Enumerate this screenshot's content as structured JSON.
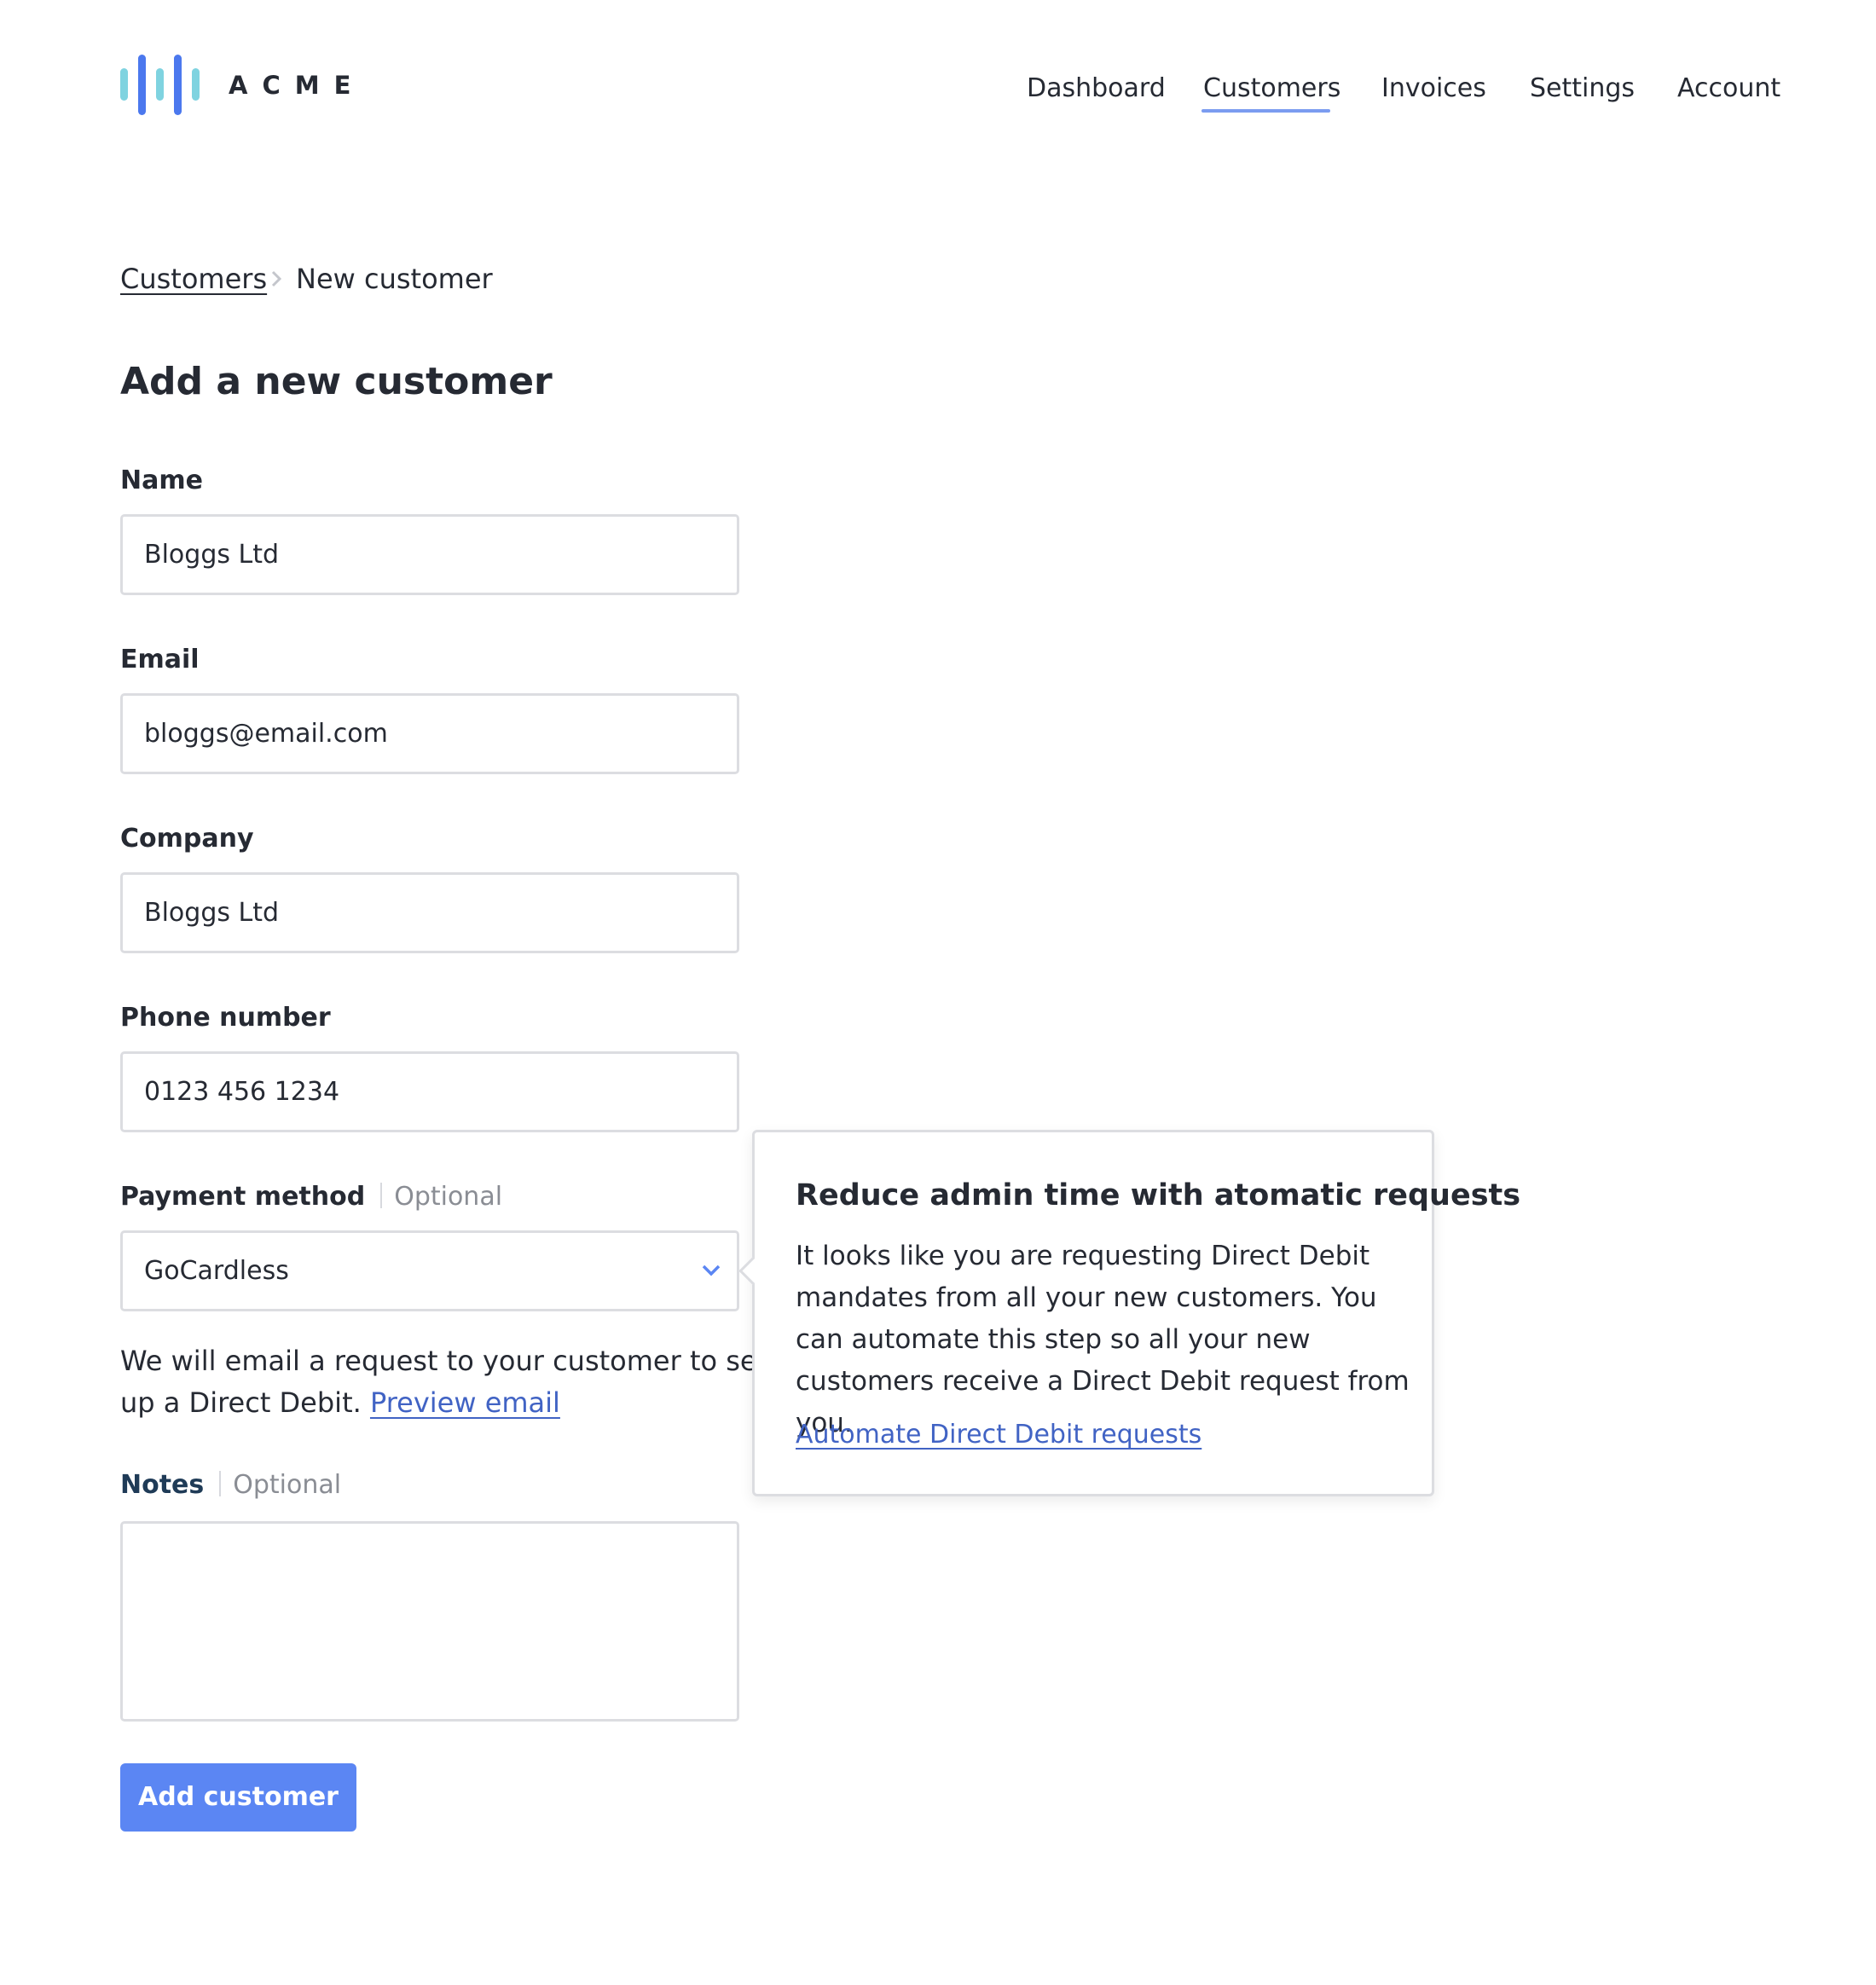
{
  "header": {
    "logo_text": "ACME",
    "nav": [
      {
        "label": "Dashboard"
      },
      {
        "label": "Customers",
        "active": true
      },
      {
        "label": "Invoices"
      },
      {
        "label": "Settings"
      },
      {
        "label": "Account"
      }
    ]
  },
  "breadcrumb": {
    "parent": "Customers",
    "current": "New customer"
  },
  "page_title": "Add a new customer",
  "form": {
    "name": {
      "label": "Name",
      "value": "Bloggs Ltd"
    },
    "email": {
      "label": "Email",
      "value": "bloggs@email.com"
    },
    "company": {
      "label": "Company",
      "value": "Bloggs Ltd"
    },
    "phone": {
      "label": "Phone number",
      "value": "0123 456 1234"
    },
    "payment_method": {
      "label": "Payment method",
      "optional": "Optional",
      "value": "GoCardless"
    },
    "helper_text": "We will email a request to your customer to set up a Direct Debit.",
    "helper_link": "Preview email",
    "notes": {
      "label": "Notes",
      "optional": "Optional",
      "value": ""
    },
    "submit_label": "Add customer"
  },
  "popover": {
    "title": "Reduce admin time with atomatic requests",
    "body": "It looks like you are requesting Direct Debit mandates from all your new customers. You can automate this step so all your new customers receive a Direct Debit request from you.",
    "link": "Automate Direct Debit requests"
  },
  "colors": {
    "accent": "#5b86f3",
    "link": "#4163c4",
    "nav_underline": "#7b9cf0",
    "logo_dark": "#4b78ee",
    "logo_light": "#7fd3e0",
    "text": "#262a33",
    "muted": "#8a8d94",
    "border": "#dcdde1"
  },
  "icons": {
    "logo": "acme-bars-logo",
    "breadcrumb_separator": "chevron-right-icon",
    "select_arrow": "chevron-down-icon"
  }
}
